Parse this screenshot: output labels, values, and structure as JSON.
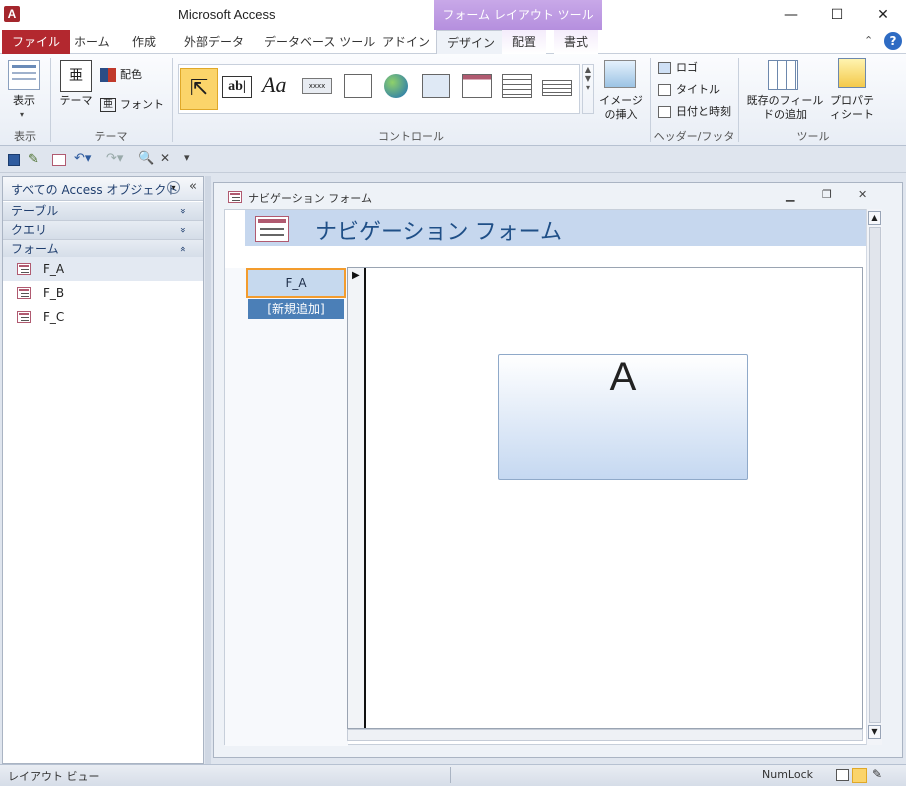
{
  "window": {
    "title": "Microsoft Access",
    "app_icon": "A",
    "contextual_tab_group": "フォーム レイアウト ツール",
    "controls": {
      "minimize": "—",
      "maximize": "☐",
      "close": "✕"
    }
  },
  "ribbon": {
    "tabs": [
      {
        "label": "ファイル"
      },
      {
        "label": "ホーム"
      },
      {
        "label": "作成"
      },
      {
        "label": "外部データ"
      },
      {
        "label": "データベース ツール"
      },
      {
        "label": "アドイン"
      },
      {
        "label": "デザイン"
      },
      {
        "label": "配置"
      },
      {
        "label": "書式"
      }
    ],
    "active_tab": "デザイン",
    "groups": {
      "view": {
        "label": "表示",
        "button": "表示"
      },
      "themes": {
        "label": "テーマ",
        "theme_button": "テーマ",
        "colors": "配色",
        "fonts": "フォント"
      },
      "controls": {
        "label": "コントロール",
        "insert_image": "イメージの挿入"
      },
      "header_footer": {
        "label": "ヘッダー/フッター",
        "logo": "ロゴ",
        "title": "タイトル",
        "date_time": "日付と時刻"
      },
      "tools": {
        "label": "ツール",
        "add_fields": "既存のフィールドの追加",
        "property_sheet": "プロパティシート"
      }
    }
  },
  "nav_pane": {
    "header": "すべての Access オブジェクト",
    "collapse_glyph": "«",
    "categories": [
      {
        "label": "テーブル",
        "glyph": "»"
      },
      {
        "label": "クエリ",
        "glyph": "»"
      },
      {
        "label": "フォーム",
        "glyph": "«"
      }
    ],
    "forms": [
      "F_A",
      "F_B",
      "F_C"
    ]
  },
  "form_window": {
    "caption": "ナビゲーション フォーム",
    "header_title": "ナビゲーション フォーム",
    "nav_tabs": [
      "F_A",
      "[新規追加]"
    ],
    "subform_content": "A"
  },
  "status_bar": {
    "mode": "レイアウト ビュー",
    "numlock": "NumLock"
  },
  "colors": {
    "file_tab": "#b3282f",
    "contextual": "#b58fde",
    "header_band": "#c6d7ee",
    "selected_nav_tab_border": "#f39c2d",
    "new_tab": "#4b7fb7"
  }
}
